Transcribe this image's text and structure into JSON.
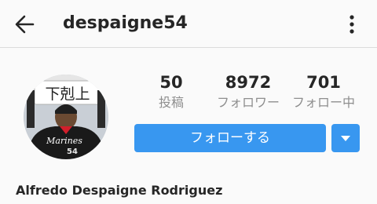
{
  "header": {
    "username": "despaigne54",
    "back_icon": "arrow-left-icon",
    "more_icon": "vertical-ellipsis-icon"
  },
  "profile": {
    "avatar_icon": "profile-photo",
    "avatar_sign_text": "下剋上",
    "avatar_jersey_text": "Marines",
    "avatar_jersey_number": "54",
    "full_name": "Alfredo Despaigne Rodriguez"
  },
  "stats": [
    {
      "value": "50",
      "label": "投稿"
    },
    {
      "value": "8972",
      "label": "フォロワー"
    },
    {
      "value": "701",
      "label": "フォロー中"
    }
  ],
  "actions": {
    "follow_label": "フォローする",
    "dropdown_icon": "caret-down-icon"
  },
  "colors": {
    "accent": "#3897f0",
    "text": "#262626",
    "muted": "#8e8e8e",
    "background": "#fafafa"
  }
}
